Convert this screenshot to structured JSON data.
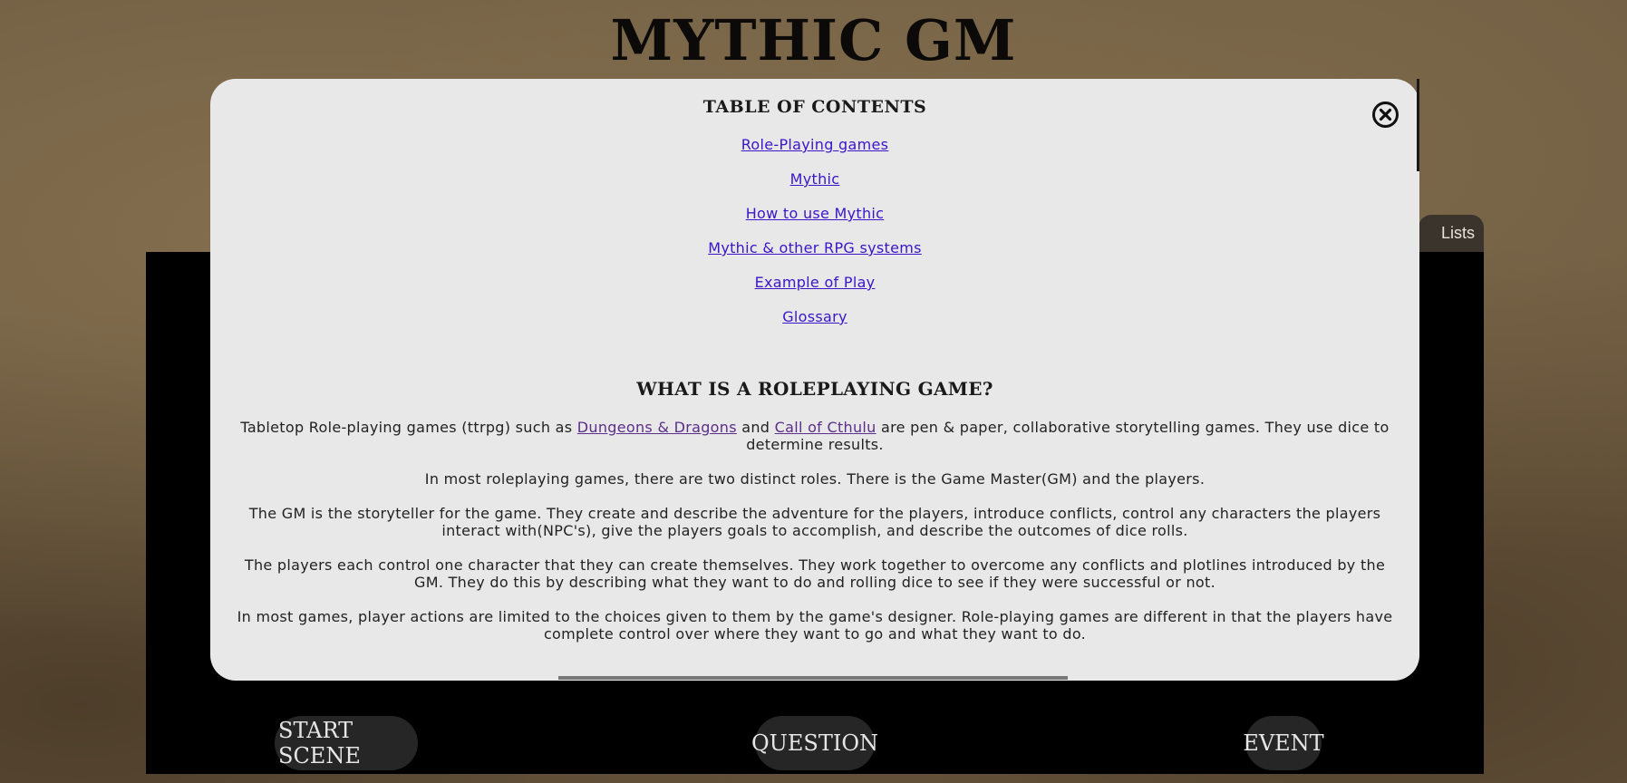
{
  "app": {
    "title": "MYTHIC GM"
  },
  "side_tab": {
    "lists_label": "Lists"
  },
  "actions": {
    "start_scene": "START SCENE",
    "question": "QUESTION",
    "event": "EVENT"
  },
  "modal": {
    "toc_heading": "TABLE OF CONTENTS",
    "toc_links": [
      "Role-Playing games",
      "Mythic",
      "How to use Mythic",
      "Mythic & other RPG systems",
      "Example of Play",
      "Glossary"
    ],
    "section_heading": "WHAT IS A ROLEPLAYING GAME?",
    "p1": {
      "before": "Tabletop Role-playing games (ttrpg) such as ",
      "link1": "Dungeons & Dragons",
      "middle": " and ",
      "link2": "Call of Cthulu",
      "after": " are pen & paper, collaborative storytelling games. They use dice to determine results."
    },
    "p2": "In most roleplaying games, there are two distinct roles. There is the Game Master(GM) and the players.",
    "p3": "The GM is the storyteller for the game. They create and describe the adventure for the players, introduce conflicts, control any characters the players interact with(NPC's), give the players goals to accomplish, and describe the outcomes of dice rolls.",
    "p4": "The players each control one character that they can create themselves. They work together to overcome any conflicts and plotlines introduced by the GM. They do this by describing what they want to do and rolling dice to see if they were successful or not.",
    "p5": "In most games, player actions are limited to the choices given to them by the game's designer. Role-playing games are different in that the players have complete control over where they want to go and what they want to do.",
    "close_icon": "close-circle-icon"
  },
  "colors": {
    "link": "#3a16c8",
    "visited_link": "#5a2e8a",
    "modal_bg": "#e8e8e8",
    "button_bg": "#262626"
  }
}
